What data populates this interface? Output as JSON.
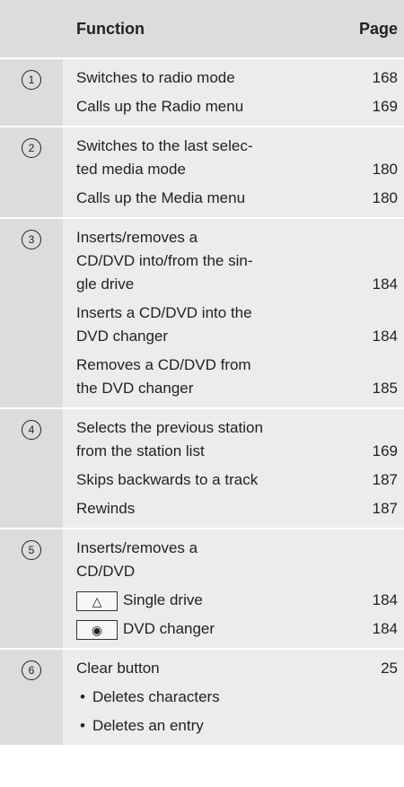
{
  "header": {
    "function": "Function",
    "page": "Page"
  },
  "sections": [
    {
      "num": "1",
      "rows": [
        {
          "text": "Switches to radio mode",
          "page": "168"
        },
        {
          "text": "Calls up the Radio menu",
          "page": "169"
        }
      ]
    },
    {
      "num": "2",
      "rows": [
        {
          "text": "Switches to the last selec-\nted media mode",
          "page": "180"
        },
        {
          "text": "Calls up the Media menu",
          "page": "180"
        }
      ]
    },
    {
      "num": "3",
      "rows": [
        {
          "text": "Inserts/removes a CD/DVD into/from the sin-gle drive",
          "page": "184"
        },
        {
          "text": "Inserts a CD/DVD into the DVD changer",
          "page": "184"
        },
        {
          "text": "Removes a CD/DVD from the DVD changer",
          "page": "185"
        }
      ]
    },
    {
      "num": "4",
      "rows": [
        {
          "text": "Selects the previous station from the station list",
          "page": "169"
        },
        {
          "text": "Skips backwards to a track",
          "page": "187"
        },
        {
          "text": "Rewinds",
          "page": "187"
        }
      ]
    },
    {
      "num": "5",
      "rows": [
        {
          "text": "Inserts/removes a CD/DVD",
          "page": ""
        },
        {
          "key": "△",
          "text": "Single drive",
          "page": "184"
        },
        {
          "key": "◉",
          "text": "DVD changer",
          "page": "184"
        }
      ]
    },
    {
      "num": "6",
      "rows": [
        {
          "text": "Clear button",
          "page": "25"
        },
        {
          "bullet": true,
          "text": "Deletes characters",
          "page": ""
        },
        {
          "bullet": true,
          "text": "Deletes an entry",
          "page": ""
        }
      ]
    }
  ]
}
